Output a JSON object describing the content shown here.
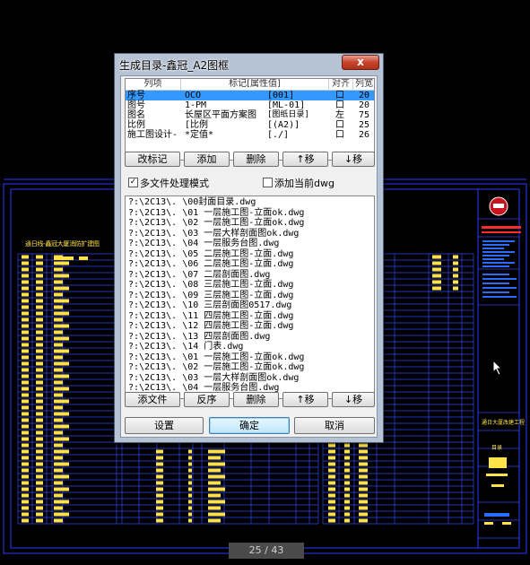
{
  "cad": {
    "drawing_title": "通日线-鑫冠大厦消防扩建图",
    "titleblock_label_1": "通日大厦改建工程",
    "titleblock_label_2": "目录",
    "page_indicator": "25 / 43"
  },
  "dialog": {
    "title": "生成目录-鑫冠_A2图框",
    "close_glyph": "x",
    "table": {
      "headers": [
        "列项",
        "标记[属性值]",
        "对齐",
        "列宽"
      ],
      "rows": [
        {
          "item": "序号",
          "tag": "OCO",
          "attr": "[001]",
          "align": "口",
          "width": "20"
        },
        {
          "item": "图号",
          "tag": "1-PM",
          "attr": "[ML-01]",
          "align": "口",
          "width": "20"
        },
        {
          "item": "图名",
          "tag": "长屋区平面方案图",
          "attr": "[图纸日录]",
          "align": "左",
          "width": "75"
        },
        {
          "item": "比例",
          "tag": "[比例",
          "attr": "[(A2)]",
          "align": "口",
          "width": "25"
        },
        {
          "item": "施工图设计-",
          "tag": "*定值*",
          "attr": "[./]",
          "align": "口",
          "width": "26"
        }
      ]
    },
    "table_buttons": [
      "改标记",
      "添加",
      "删除",
      "↑移",
      "↓移"
    ],
    "multi_file_mode": {
      "label": "多文件处理模式",
      "checked": true
    },
    "add_current_dwg": {
      "label": "添加当前dwg",
      "checked": false
    },
    "files": [
      "?:\\2C13\\. \\00封面目录.dwg",
      "?:\\2C13\\. \\01 一层施工图-立面ok.dwg",
      "?:\\2C13\\. \\02 一层施工图-立面ok.dwg",
      "?:\\2C13\\. \\03 一层大样剖面图ok.dwg",
      "?:\\2C13\\. \\04 一层服务台图.dwg",
      "?:\\2C13\\. \\05 二层施工图-立面.dwg",
      "?:\\2C13\\. \\06 二层施工图-立面.dwg",
      "?:\\2C13\\. \\07 二层剖面图.dwg",
      "?:\\2C13\\. \\08 三层施工图-立面.dwg",
      "?:\\2C13\\. \\09 三层施工图-立面.dwg",
      "?:\\2C13\\. \\10 三层剖面图0517.dwg",
      "?:\\2C13\\. \\11 四层施工图-立面.dwg",
      "?:\\2C13\\. \\12 四层施工图-立面.dwg",
      "?:\\2C13\\. \\13 四层剖面图.dwg",
      "?:\\2C13\\. \\14 门表.dwg",
      "?:\\2C13\\. \\01 一层施工图-立面ok.dwg",
      "?:\\2C13\\. \\02 一层施工图-立面ok.dwg",
      "?:\\2C13\\. \\03 一层大样剖面图ok.dwg",
      "?:\\2C13\\. \\04 一层服务台图.dwg"
    ],
    "list_buttons": [
      "添文件",
      "反序",
      "删除",
      "↑移",
      "↓移"
    ],
    "footer_buttons": {
      "settings": "设置",
      "ok": "确定",
      "cancel": "取消"
    }
  },
  "colors": {
    "cad_blue": "#2a3cff",
    "cad_yellow": "#ffe24a",
    "cad_red": "#ff2020"
  }
}
